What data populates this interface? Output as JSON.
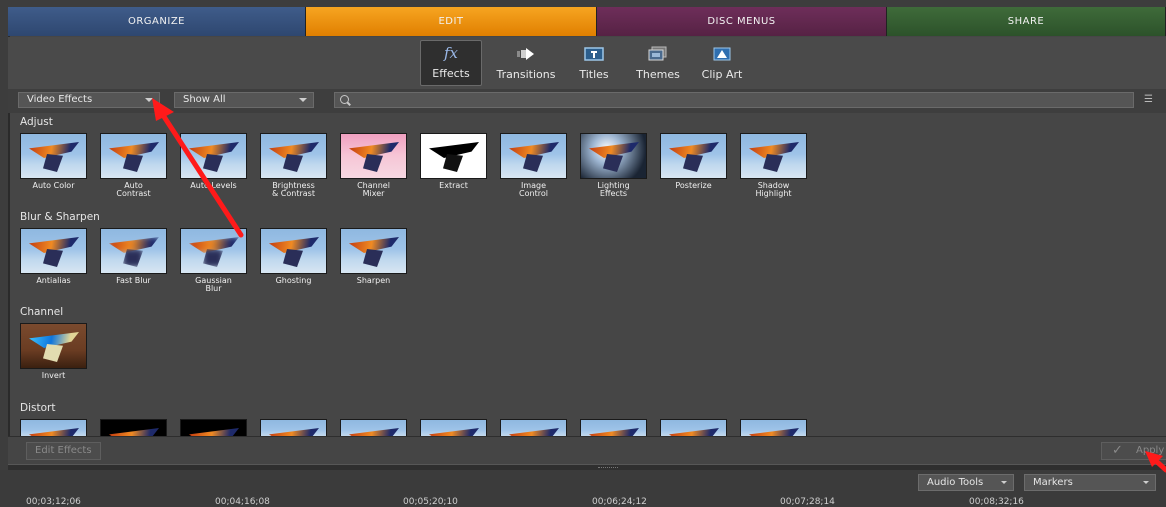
{
  "workspace_tabs": [
    "ORGANIZE",
    "EDIT",
    "DISC MENUS",
    "SHARE"
  ],
  "categories": [
    {
      "label": "Effects",
      "icon": "fx-icon"
    },
    {
      "label": "Transitions",
      "icon": "transitions-icon"
    },
    {
      "label": "Titles",
      "icon": "titles-icon"
    },
    {
      "label": "Themes",
      "icon": "themes-icon"
    },
    {
      "label": "Clip Art",
      "icon": "clip-art-icon"
    }
  ],
  "filters": {
    "effect_type": "Video Effects",
    "show": "Show All",
    "search_value": ""
  },
  "sections": [
    {
      "title": "Adjust",
      "effects": [
        "Auto Color",
        "Auto\nContrast",
        "Auto Levels",
        "Brightness\n& Contrast",
        "Channel\nMixer",
        "Extract",
        "Image\nControl",
        "Lighting\nEffects",
        "Posterize",
        "Shadow\nHighlight"
      ]
    },
    {
      "title": "Blur & Sharpen",
      "effects": [
        "Antialias",
        "Fast Blur",
        "Gaussian\nBlur",
        "Ghosting",
        "Sharpen"
      ]
    },
    {
      "title": "Channel",
      "effects": [
        "Invert"
      ]
    },
    {
      "title": "Distort",
      "effects": []
    }
  ],
  "actions": {
    "edit_effects": "Edit Effects",
    "apply": "Apply"
  },
  "timeline": {
    "audio_tools": "Audio Tools",
    "markers": "Markers",
    "timecodes": [
      "00;03;12;06",
      "00;04;16;08",
      "00;05;20;10",
      "00;06;24;12",
      "00;07;28;14",
      "00;08;32;16"
    ]
  },
  "colors": {
    "organize": "#34507e",
    "edit": "#ee9212",
    "disc_menus": "#62284f",
    "share": "#355f33",
    "annotation_arrow": "#ff0000"
  }
}
